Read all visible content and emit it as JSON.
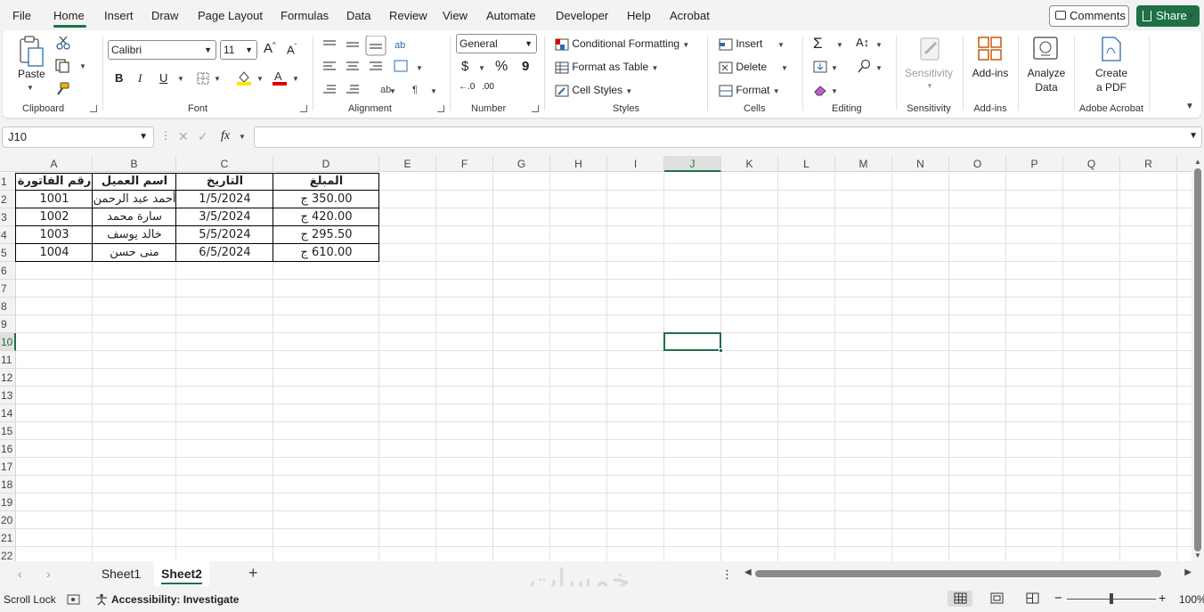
{
  "menu": {
    "items": [
      "File",
      "Home",
      "Insert",
      "Draw",
      "Page Layout",
      "Formulas",
      "Data",
      "Review",
      "View",
      "Automate",
      "Developer",
      "Help",
      "Acrobat"
    ],
    "active": "Home",
    "comments_label": "Comments",
    "share_label": "Share"
  },
  "ribbon": {
    "clipboard": {
      "paste": "Paste",
      "label": "Clipboard"
    },
    "font": {
      "name": "Calibri",
      "size": "11",
      "bold": "B",
      "italic": "I",
      "underline": "U",
      "label": "Font"
    },
    "alignment": {
      "label": "Alignment"
    },
    "number": {
      "format": "General",
      "currency": "$",
      "percent": "%",
      "comma": "9",
      "label": "Number"
    },
    "styles": {
      "conditional": "Conditional Formatting",
      "table": "Format as Table",
      "cell_styles": "Cell Styles",
      "label": "Styles"
    },
    "cells": {
      "insert": "Insert",
      "delete": "Delete",
      "format": "Format",
      "label": "Cells"
    },
    "editing": {
      "label": "Editing"
    },
    "sensitivity": {
      "button": "Sensitivity",
      "label": "Sensitivity"
    },
    "addins": {
      "button": "Add-ins",
      "label": "Add-ins"
    },
    "analyze": {
      "line1": "Analyze",
      "line2": "Data"
    },
    "acrobat": {
      "line1": "Create",
      "line2": "a PDF",
      "label": "Adobe Acrobat"
    }
  },
  "formula_bar": {
    "name_box": "J10",
    "fx": "fx",
    "formula": ""
  },
  "grid": {
    "columns": [
      "A",
      "B",
      "C",
      "D",
      "E",
      "F",
      "G",
      "H",
      "I",
      "J",
      "K",
      "L",
      "M",
      "N",
      "O",
      "P",
      "Q",
      "R"
    ],
    "rows": [
      "1",
      "2",
      "3",
      "4",
      "5",
      "6",
      "7",
      "8",
      "9",
      "10",
      "11",
      "12",
      "13",
      "14",
      "15",
      "16",
      "17",
      "18",
      "19",
      "20",
      "21",
      "22"
    ],
    "selected_cell": "J10",
    "table": {
      "headers": [
        "رقم الفاتورة",
        "اسم العميل",
        "التاريخ",
        "المبلغ"
      ],
      "rows": [
        [
          "1001",
          "أحمد عبد الرحمن",
          "1/5/2024",
          "350.00 ج"
        ],
        [
          "1002",
          "سارة محمد",
          "3/5/2024",
          "420.00 ج"
        ],
        [
          "1003",
          "خالد يوسف",
          "5/5/2024",
          "295.50 ج"
        ],
        [
          "1004",
          "منى حسن",
          "6/5/2024",
          "610.00 ج"
        ]
      ]
    }
  },
  "sheets": {
    "tabs": [
      "Sheet1",
      "Sheet2"
    ],
    "active": "Sheet2"
  },
  "watermark": "خمسات",
  "status": {
    "scroll_lock": "Scroll Lock",
    "accessibility": "Accessibility: Investigate",
    "zoom": "100%"
  },
  "colors": {
    "accent": "#1e7145"
  }
}
